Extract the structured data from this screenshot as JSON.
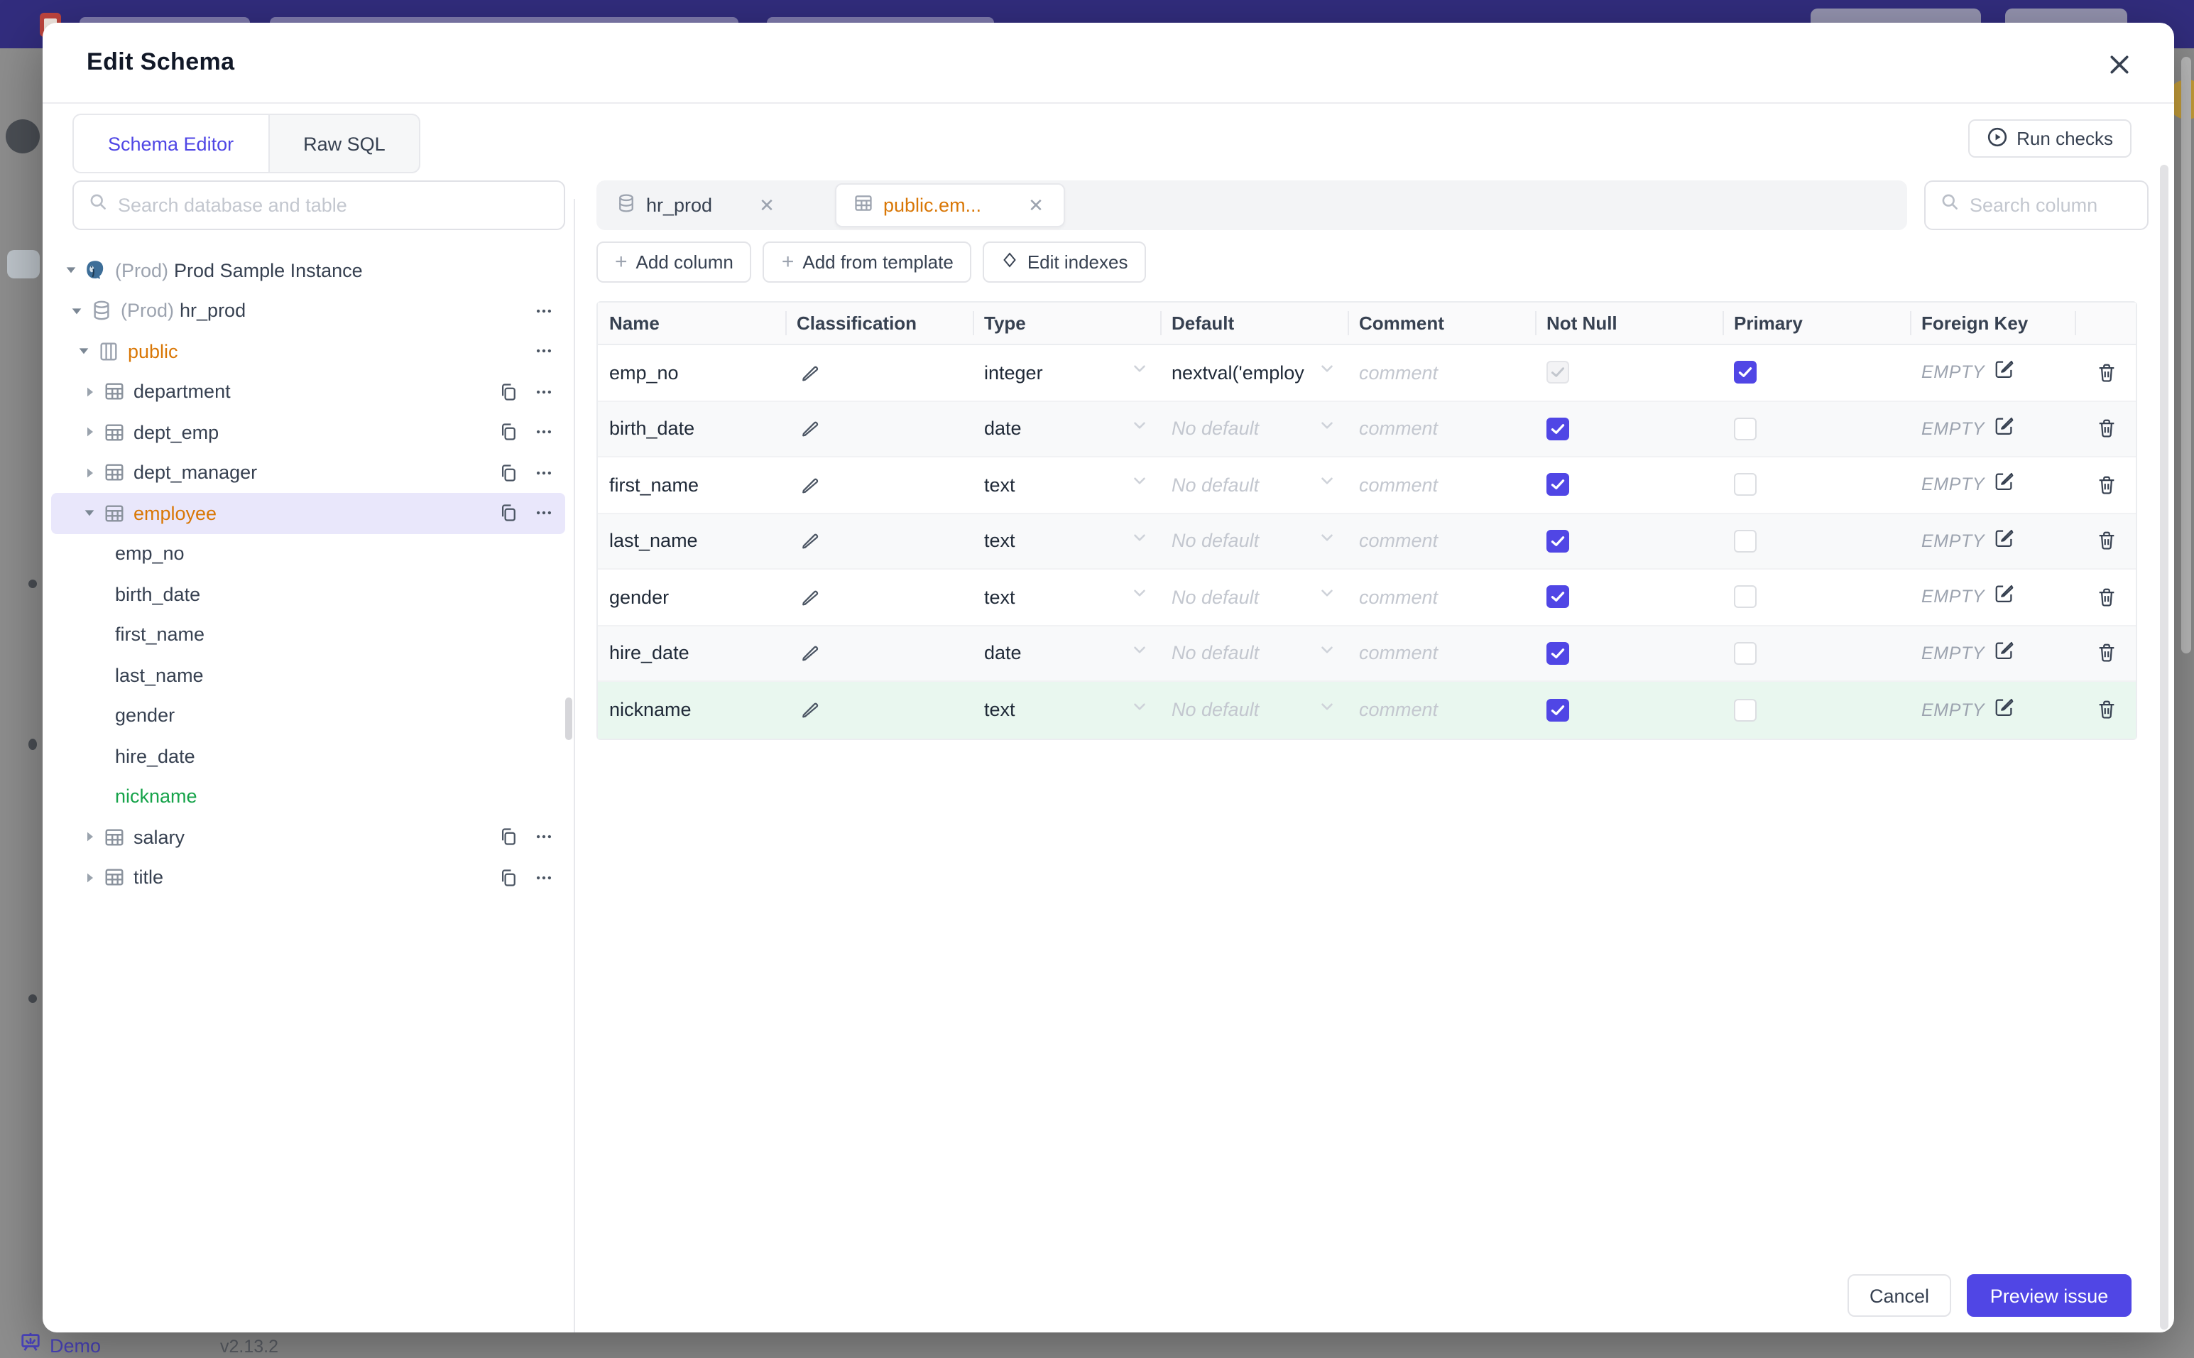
{
  "backdrop": {
    "demo_label": "Demo",
    "version": "v2.13.2"
  },
  "modal": {
    "title": "Edit Schema",
    "close_icon": "x",
    "tabs": [
      {
        "label": "Schema Editor",
        "active": true
      },
      {
        "label": "Raw SQL",
        "active": false
      }
    ],
    "run_checks_label": "Run checks",
    "cancel_label": "Cancel",
    "preview_label": "Preview issue"
  },
  "sidebar": {
    "search_placeholder": "Search database and table",
    "tree": [
      {
        "level": 0,
        "caret": "down",
        "icon": "postgres",
        "prefix": "(Prod)",
        "label": "Prod Sample Instance"
      },
      {
        "level": 1,
        "caret": "down",
        "icon": "database",
        "prefix": "(Prod)",
        "label": "hr_prod",
        "actions": [
          "menu"
        ]
      },
      {
        "level": 2,
        "caret": "down",
        "icon": "schema",
        "label": "public",
        "color": "amber",
        "actions": [
          "menu"
        ]
      },
      {
        "level": 3,
        "caret": "right",
        "icon": "table",
        "label": "department",
        "actions": [
          "copy",
          "menu"
        ]
      },
      {
        "level": 3,
        "caret": "right",
        "icon": "table",
        "label": "dept_emp",
        "actions": [
          "copy",
          "menu"
        ]
      },
      {
        "level": 3,
        "caret": "right",
        "icon": "table",
        "label": "dept_manager",
        "actions": [
          "copy",
          "menu"
        ]
      },
      {
        "level": 3,
        "caret": "down",
        "icon": "table",
        "label": "employee",
        "color": "amber",
        "selected": true,
        "actions": [
          "copy",
          "menu"
        ]
      },
      {
        "level": 4,
        "label": "emp_no"
      },
      {
        "level": 4,
        "label": "birth_date"
      },
      {
        "level": 4,
        "label": "first_name"
      },
      {
        "level": 4,
        "label": "last_name"
      },
      {
        "level": 4,
        "label": "gender"
      },
      {
        "level": 4,
        "label": "hire_date"
      },
      {
        "level": 4,
        "label": "nickname",
        "color": "green"
      },
      {
        "level": 3,
        "caret": "right",
        "icon": "table",
        "label": "salary",
        "actions": [
          "copy",
          "menu"
        ]
      },
      {
        "level": 3,
        "caret": "right",
        "icon": "table",
        "label": "title",
        "actions": [
          "copy",
          "menu"
        ]
      }
    ]
  },
  "editor": {
    "tabs": [
      {
        "label": "hr_prod",
        "icon": "database",
        "active": false
      },
      {
        "label": "public.em...",
        "icon": "table",
        "active": true
      }
    ],
    "toolbar": {
      "add_column": "Add column",
      "add_from_template": "Add from template",
      "edit_indexes": "Edit indexes"
    },
    "search_placeholder": "Search column",
    "table": {
      "headers": [
        "Name",
        "Classification",
        "Type",
        "Default",
        "Comment",
        "Not Null",
        "Primary",
        "Foreign Key",
        ""
      ],
      "comment_placeholder": "comment",
      "foreign_key_label": "EMPTY",
      "rows": [
        {
          "name": "emp_no",
          "type": "integer",
          "default": "nextval('employ",
          "default_set": true,
          "not_null": "checked-disabled",
          "primary": true,
          "highlight": null
        },
        {
          "name": "birth_date",
          "type": "date",
          "default": "No default",
          "default_set": false,
          "not_null": "checked",
          "primary": false,
          "highlight": null
        },
        {
          "name": "first_name",
          "type": "text",
          "default": "No default",
          "default_set": false,
          "not_null": "checked",
          "primary": false,
          "highlight": null
        },
        {
          "name": "last_name",
          "type": "text",
          "default": "No default",
          "default_set": false,
          "not_null": "checked",
          "primary": false,
          "highlight": null
        },
        {
          "name": "gender",
          "type": "text",
          "default": "No default",
          "default_set": false,
          "not_null": "checked",
          "primary": false,
          "highlight": null
        },
        {
          "name": "hire_date",
          "type": "date",
          "default": "No default",
          "default_set": false,
          "not_null": "checked",
          "primary": false,
          "highlight": null
        },
        {
          "name": "nickname",
          "type": "text",
          "default": "No default",
          "default_set": false,
          "not_null": "checked",
          "primary": false,
          "highlight": "green"
        }
      ]
    }
  },
  "colors": {
    "accent": "#5046e5",
    "amber": "#d97706",
    "green": "#16a34a",
    "topbar": "#322d7e",
    "selected_row": "#e9e7fb",
    "green_row": "#e9f7ef"
  }
}
